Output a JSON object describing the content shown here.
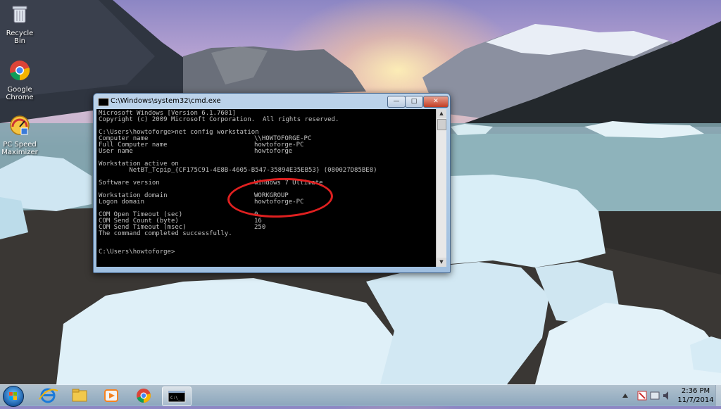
{
  "desktop": {
    "icons": [
      {
        "label": "Recycle Bin"
      },
      {
        "label": "Google\nChrome"
      },
      {
        "label": "PC Speed\nMaximizer"
      }
    ]
  },
  "window": {
    "title": "C:\\Windows\\system32\\cmd.exe",
    "controls": {
      "minimize": "—",
      "maximize": "□",
      "close": "✕"
    }
  },
  "console": {
    "header_lines": [
      "Microsoft Windows [Version 6.1.7601]",
      "Copyright (c) 2009 Microsoft Corporation.  All rights reserved."
    ],
    "command": "C:\\Users\\howtoforge>net config workstation",
    "rows": [
      {
        "key": "Computer name",
        "value": "\\\\HOWTOFORGE-PC"
      },
      {
        "key": "Full Computer name",
        "value": "howtoforge-PC"
      },
      {
        "key": "User name",
        "value": "howtoforge"
      }
    ],
    "active_label": "Workstation active on",
    "active_value": "        NetBT_Tcpip_{CF175C91-4E8B-4605-B547-35894E35EB53} (080027D85BE8)",
    "software": {
      "key": "Software version",
      "value": "Windows 7 Ultimate"
    },
    "domain_rows": [
      {
        "key": "Workstation domain",
        "value": "WORKGROUP"
      },
      {
        "key": "Logon domain",
        "value": "howtoforge-PC"
      }
    ],
    "com_rows": [
      {
        "key": "COM Open Timeout (sec)",
        "value": "0"
      },
      {
        "key": "COM Send Count (byte)",
        "value": "16"
      },
      {
        "key": "COM Send Timeout (msec)",
        "value": "250"
      }
    ],
    "completion": "The command completed successfully.",
    "prompt": "C:\\Users\\howtoforge>"
  },
  "taskbar": {
    "clock_time": "2:36 PM",
    "clock_date": "11/7/2014"
  },
  "colors": {
    "console_text": "#c0c0c0",
    "highlight": "#e02020"
  }
}
